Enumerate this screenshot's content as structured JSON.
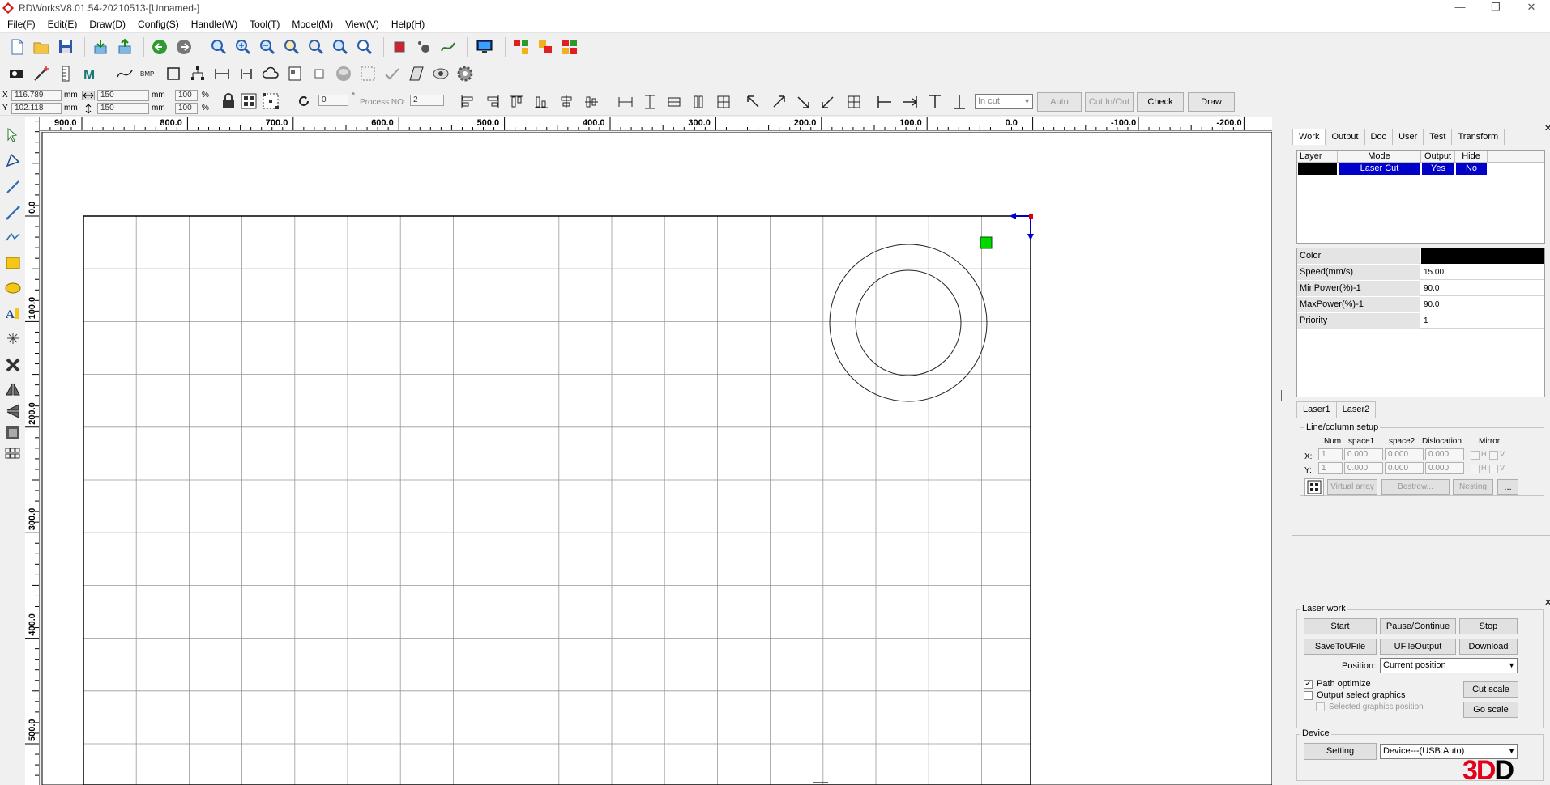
{
  "window": {
    "title": "RDWorksV8.01.54-20210513-[Unnamed-]",
    "minimize": "—",
    "restore": "❐",
    "close": "✕"
  },
  "menu": [
    "File(F)",
    "Edit(E)",
    "Draw(D)",
    "Config(S)",
    "Handle(W)",
    "Tool(T)",
    "Model(M)",
    "View(V)",
    "Help(H)"
  ],
  "coords": {
    "x_label": "X",
    "y_label": "Y",
    "x_value": "116.789",
    "y_value": "102.118",
    "unit": "mm",
    "width_value": "150",
    "height_value": "150",
    "width_pct": "100",
    "height_pct": "100",
    "pct": "%",
    "rotation_value": "0",
    "degree": "°",
    "process_label": "Process NO:",
    "process_value": "2",
    "cut_mode": "In cut",
    "auto_label": "Auto",
    "cut_in_out_label": "Cut In/Out",
    "check_label": "Check",
    "draw_label": "Draw"
  },
  "ruler": {
    "h_labels": [
      "900.0",
      "800.0",
      "700.0",
      "600.0",
      "500.0",
      "400.0",
      "300.0",
      "200.0",
      "100.0",
      "0.0",
      "-100.0",
      "-200.0"
    ],
    "v_labels": [
      "0.0",
      "100.0",
      "200.0",
      "300.0",
      "400.0",
      "500.0"
    ]
  },
  "panel": {
    "tabs": [
      "Work",
      "Output",
      "Doc",
      "User",
      "Test",
      "Transform"
    ],
    "layer_headers": [
      "Layer",
      "Mode",
      "Output",
      "Hide"
    ],
    "layer_row": {
      "color": "#000000",
      "mode": "Laser Cut",
      "output": "Yes",
      "hide": "No"
    },
    "props": [
      {
        "key": "Color",
        "value": ""
      },
      {
        "key": "Speed(mm/s)",
        "value": "15.00"
      },
      {
        "key": "MinPower(%)-1",
        "value": "90.0"
      },
      {
        "key": "MaxPower(%)-1",
        "value": "90.0"
      },
      {
        "key": "Priority",
        "value": "1"
      }
    ],
    "laser_tabs": [
      "Laser1",
      "Laser2"
    ],
    "linecol": {
      "title": "Line/column setup",
      "headers": [
        "Num",
        "space1",
        "space2",
        "Dislocation",
        "Mirror"
      ],
      "x_label": "X:",
      "y_label": "Y:",
      "x_values": [
        "1",
        "0.000",
        "0.000",
        "0.000"
      ],
      "y_values": [
        "1",
        "0.000",
        "0.000",
        "0.000"
      ],
      "h": "H",
      "v": "V",
      "virtual_array": "Virtual array",
      "bestrew": "Bestrew...",
      "nesting": "Nesting",
      "more": "..."
    },
    "laser_work": {
      "title": "Laser work",
      "start": "Start",
      "pause": "Pause/Continue",
      "stop": "Stop",
      "save_to_ufile": "SaveToUFile",
      "ufile_output": "UFileOutput",
      "download": "Download",
      "position_label": "Position:",
      "position_value": "Current position",
      "path_optimize": "Path optimize",
      "output_select": "Output select graphics",
      "selected_position": "Selected graphics position",
      "cut_scale": "Cut scale",
      "go_scale": "Go scale"
    },
    "device": {
      "title": "Device",
      "setting": "Setting",
      "device_value": "Device---(USB:Auto)"
    }
  },
  "watermark": {
    "red": "3D",
    "black": "D"
  },
  "colors": {
    "selection_blue": "#0000c8",
    "green_marker": "#00d800",
    "origin_red": "#e00000"
  }
}
